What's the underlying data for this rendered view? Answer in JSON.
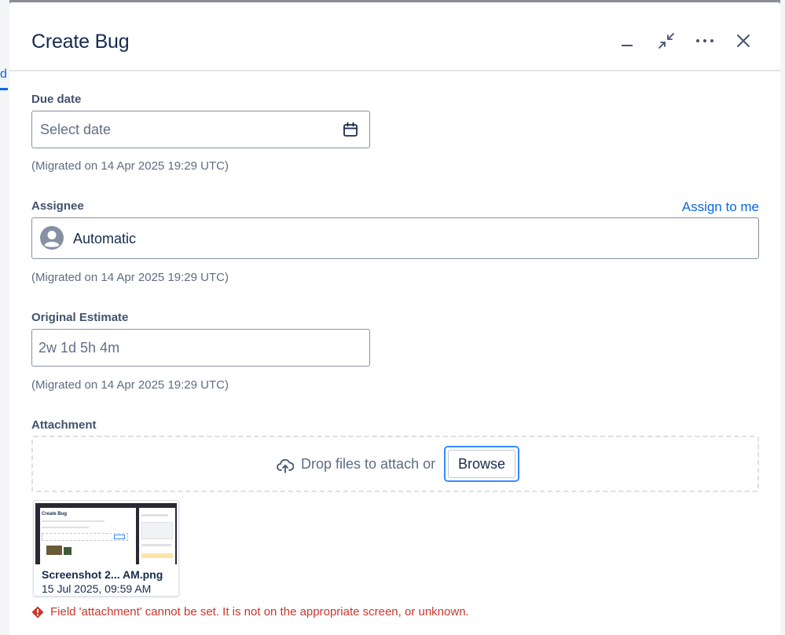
{
  "background": {
    "tab_fragment": "d"
  },
  "modal": {
    "title": "Create Bug",
    "header_actions": [
      "minimize-icon",
      "collapse-icon",
      "more-icon",
      "close-icon"
    ]
  },
  "due_date": {
    "label": "Due date",
    "placeholder": "Select date",
    "helper": "(Migrated on 14 Apr 2025 19:29 UTC)"
  },
  "assignee": {
    "label": "Assignee",
    "assign_to_me": "Assign to me",
    "value": "Automatic",
    "helper": "(Migrated on 14 Apr 2025 19:29 UTC)"
  },
  "original_estimate": {
    "label": "Original Estimate",
    "value": "2w 1d 5h 4m",
    "helper": "(Migrated on 14 Apr 2025 19:29 UTC)"
  },
  "attachment": {
    "label": "Attachment",
    "drop_text": "Drop files to attach or",
    "browse": "Browse",
    "file": {
      "name": "Screenshot 2...  AM.png",
      "date": "15 Jul 2025, 09:59 AM",
      "thumb_title": "Create Bug"
    },
    "error": "Field 'attachment' cannot be set. It is not on the appropriate screen, or unknown."
  },
  "colors": {
    "link": "#0c66e4",
    "error": "#c9372c",
    "focus": "#388bff"
  }
}
